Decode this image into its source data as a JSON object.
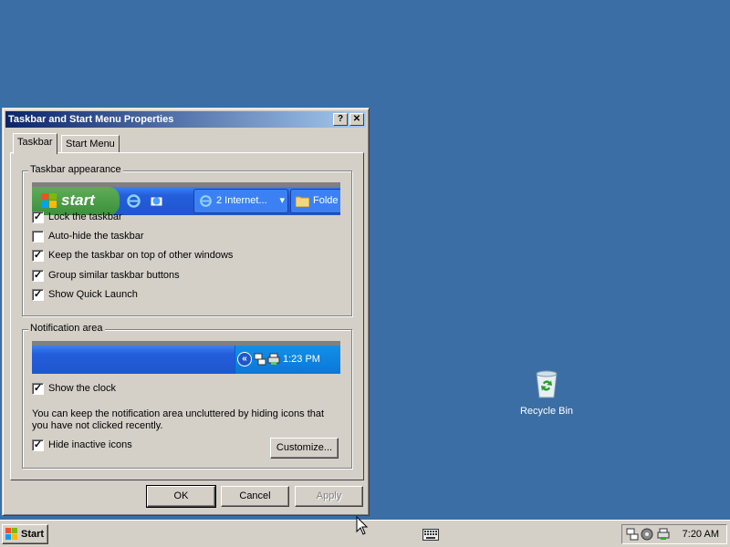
{
  "desktop": {
    "background": "#3a6ea5",
    "icons": [
      {
        "label": "Recycle Bin",
        "icon": "recycle-bin-icon"
      }
    ]
  },
  "dialog": {
    "title": "Taskbar and Start Menu Properties",
    "help_glyph": "?",
    "close_glyph": "✕",
    "tabs": [
      {
        "label": "Taskbar",
        "active": true
      },
      {
        "label": "Start Menu",
        "active": false
      }
    ],
    "taskbar_appearance": {
      "title": "Taskbar appearance",
      "preview": {
        "start_label": "start",
        "task_button_label": "2 Internet...",
        "folder_button_label": "Folde"
      },
      "options": [
        {
          "label": "Lock the taskbar",
          "checked": true
        },
        {
          "label": "Auto-hide the taskbar",
          "checked": false
        },
        {
          "label": "Keep the taskbar on top of other windows",
          "checked": true
        },
        {
          "label": "Group similar taskbar buttons",
          "checked": true
        },
        {
          "label": "Show Quick Launch",
          "checked": true
        }
      ]
    },
    "notification_area": {
      "title": "Notification area",
      "preview_time": "1:23 PM",
      "chevron": "«",
      "show_clock": {
        "label": "Show the clock",
        "checked": true
      },
      "description": "You can keep the notification area uncluttered by hiding icons that you have not clicked recently.",
      "hide_inactive": {
        "label": "Hide inactive icons",
        "checked": true
      },
      "customize_label": "Customize..."
    },
    "buttons": {
      "ok": "OK",
      "cancel": "Cancel",
      "apply": "Apply"
    }
  },
  "taskbar": {
    "start_label": "Start",
    "clock": "7:20 AM"
  }
}
